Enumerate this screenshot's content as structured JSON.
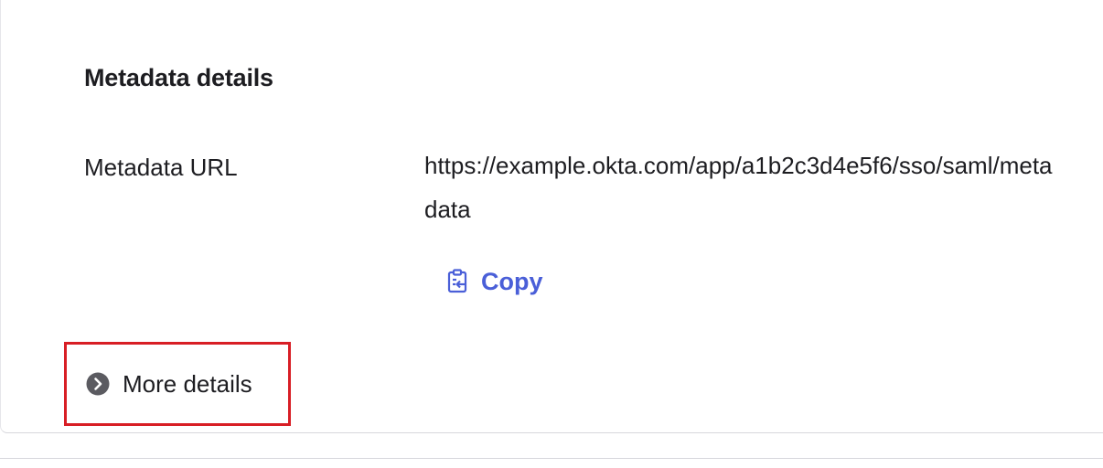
{
  "section": {
    "title": "Metadata details"
  },
  "metadata_url": {
    "label": "Metadata URL",
    "value": "https://example.okta.com/app/a1b2c3d4e5f6/sso/saml/metadata"
  },
  "copy_button": {
    "label": "Copy",
    "icon": "clipboard-copy-icon",
    "color": "#4a5fd8"
  },
  "more_details": {
    "label": "More details",
    "icon": "chevron-right-circle-icon",
    "highlight_color": "#d81e25"
  }
}
